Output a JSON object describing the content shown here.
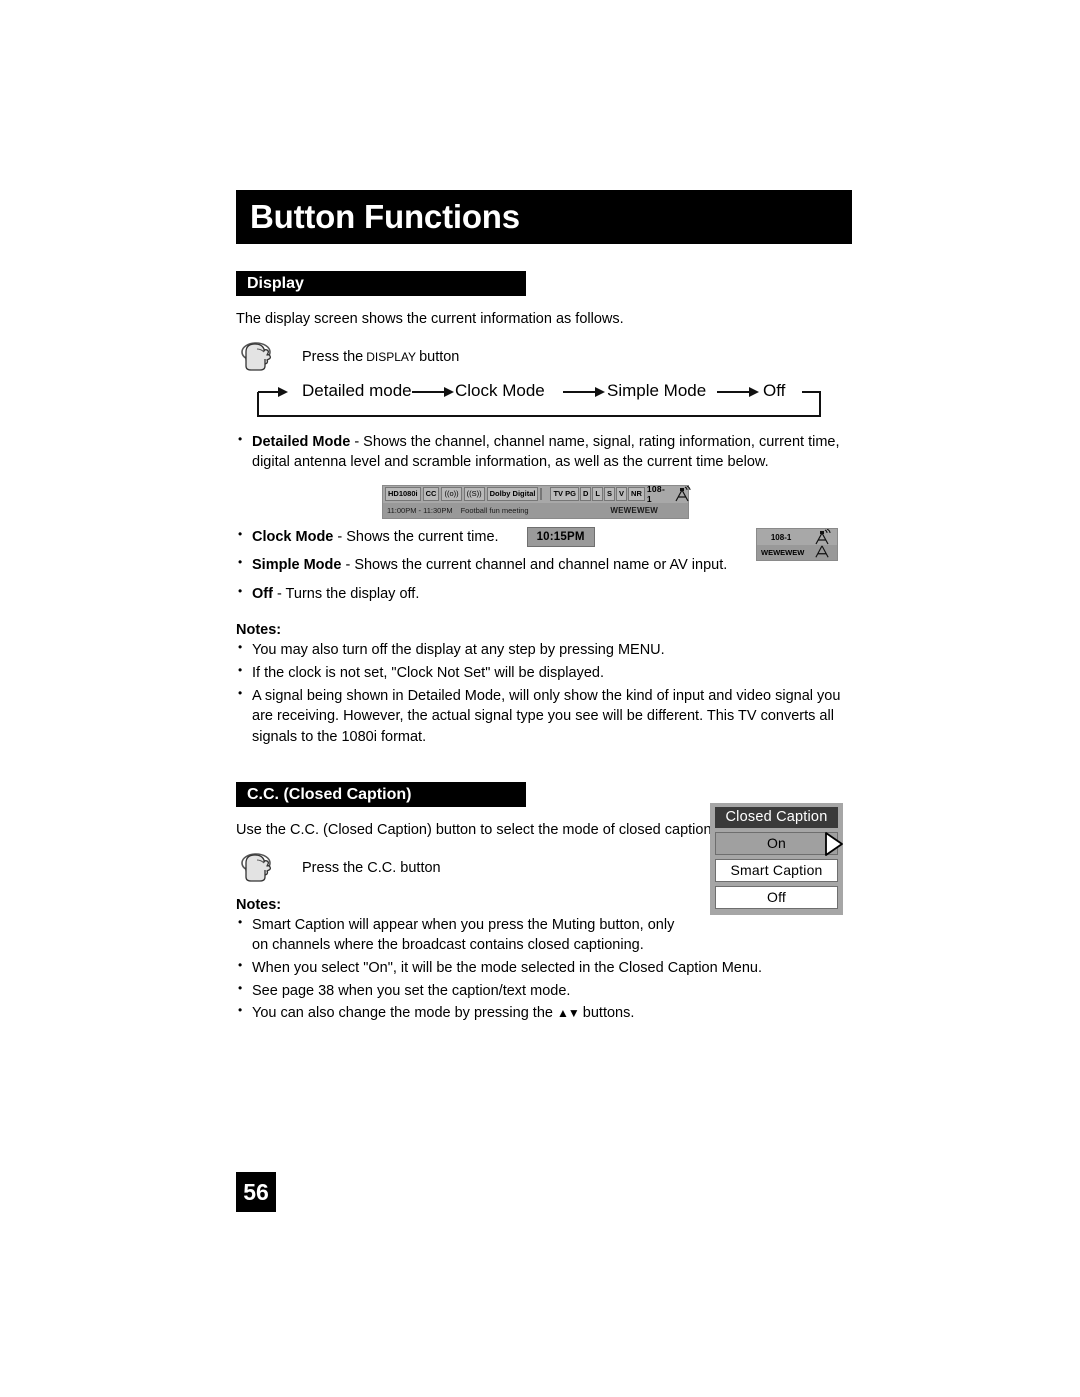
{
  "page": {
    "title": "Button Functions",
    "number": "56"
  },
  "display_section": {
    "heading": "Display",
    "intro": "The display screen shows the current information as follows.",
    "press_prefix": "Press the",
    "press_key": "Display",
    "press_suffix": "button",
    "flow": [
      "Detailed mode",
      "Clock Mode",
      "Simple Mode",
      "Off"
    ],
    "modes": [
      {
        "name": "Detailed Mode",
        "desc": " - Shows the channel, channel name, signal, rating information, current time, digital antenna level and scramble information, as well as the current time below."
      },
      {
        "name": "Clock Mode",
        "desc": " - Shows the current time."
      },
      {
        "name": "Simple Mode",
        "desc": " - Shows the current channel and channel name or AV input."
      },
      {
        "name": "Off",
        "desc": " - Turns the display off."
      }
    ],
    "clock_badge": "10:15PM",
    "notes_title": "Notes:",
    "notes": [
      "You may also turn off the display at any step by pressing MENU.",
      "If the clock is not set, \"Clock Not Set\" will be displayed.",
      "A signal being shown in Detailed Mode, will only show the kind of input and video signal you are receiving.  However, the actual signal type you see will be different.  This TV converts all signals to the 1080i format."
    ]
  },
  "osd_detailed": {
    "chips": [
      "HD1080i",
      "CC",
      "((o))",
      "((S))",
      "Dolby Digital"
    ],
    "rating_chips": [
      "TV PG",
      "D",
      "L",
      "S",
      "V",
      "NR"
    ],
    "channel": "108-1",
    "time_range": "11:00PM - 11:30PM",
    "program": "Football fun meeting",
    "station": "WEWEWEW"
  },
  "osd_simple": {
    "channel": "108-1",
    "station": "WEWEWEW"
  },
  "cc_section": {
    "heading": "C.C. (Closed Caption)",
    "intro": "Use the C.C. (Closed Caption) button to select the mode of closed caption.",
    "press_label": "Press the C.C. button",
    "notes_title": "Notes:",
    "notes": [
      "Smart Caption will appear when you press the Muting button, only on channels where the broadcast contains closed captioning.",
      "When you select \"On\", it will be the mode selected in the Closed Caption Menu.",
      "See page 38 when you set the caption/text mode.",
      "You can also change the mode by pressing the"
    ],
    "note_last_suffix": "buttons.",
    "updown_glyph": "▲▼"
  },
  "cc_menu": {
    "title": "Closed Caption",
    "items": [
      "On",
      "Smart Caption",
      "Off"
    ],
    "selected": "On"
  },
  "colors": {
    "header_bg": "#000000",
    "osd_bg": "#a8a8a8",
    "menu_selected": "#a0a0a0"
  }
}
